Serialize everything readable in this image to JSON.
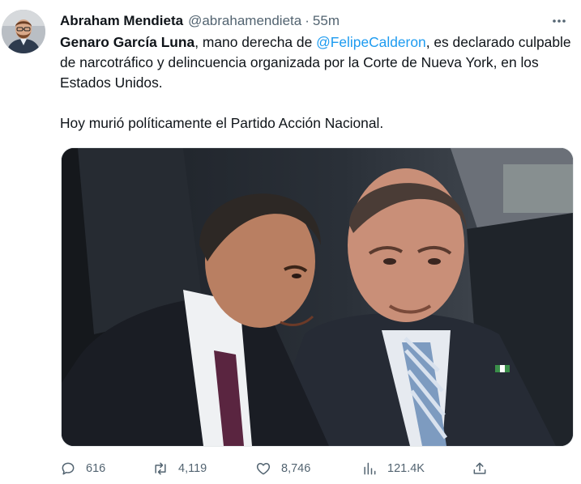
{
  "author": {
    "name": "Abraham Mendieta",
    "handle": "@abrahamendieta",
    "separator": "·",
    "time": "55m"
  },
  "tweet": {
    "bold_name": "Genaro García Luna",
    "text_1": ", mano derecha de ",
    "mention": "@FelipeCalderon",
    "text_2": ", es declarado culpable de narcotráfico y delincuencia organizada por la Corte de Nueva York, en los Estados Unidos.",
    "paragraph_2": "Hoy murió políticamente el Partido Acción Nacional."
  },
  "actions": {
    "replies": "616",
    "retweets": "4,119",
    "likes": "8,746",
    "views": "121.4K"
  },
  "icons": {
    "reply": "reply-icon",
    "retweet": "retweet-icon",
    "like": "heart-icon",
    "views": "views-icon",
    "share": "share-icon",
    "more": "more-icon"
  },
  "colors": {
    "text": "#0f1419",
    "secondary": "#536471",
    "link": "#1d9bf0"
  }
}
